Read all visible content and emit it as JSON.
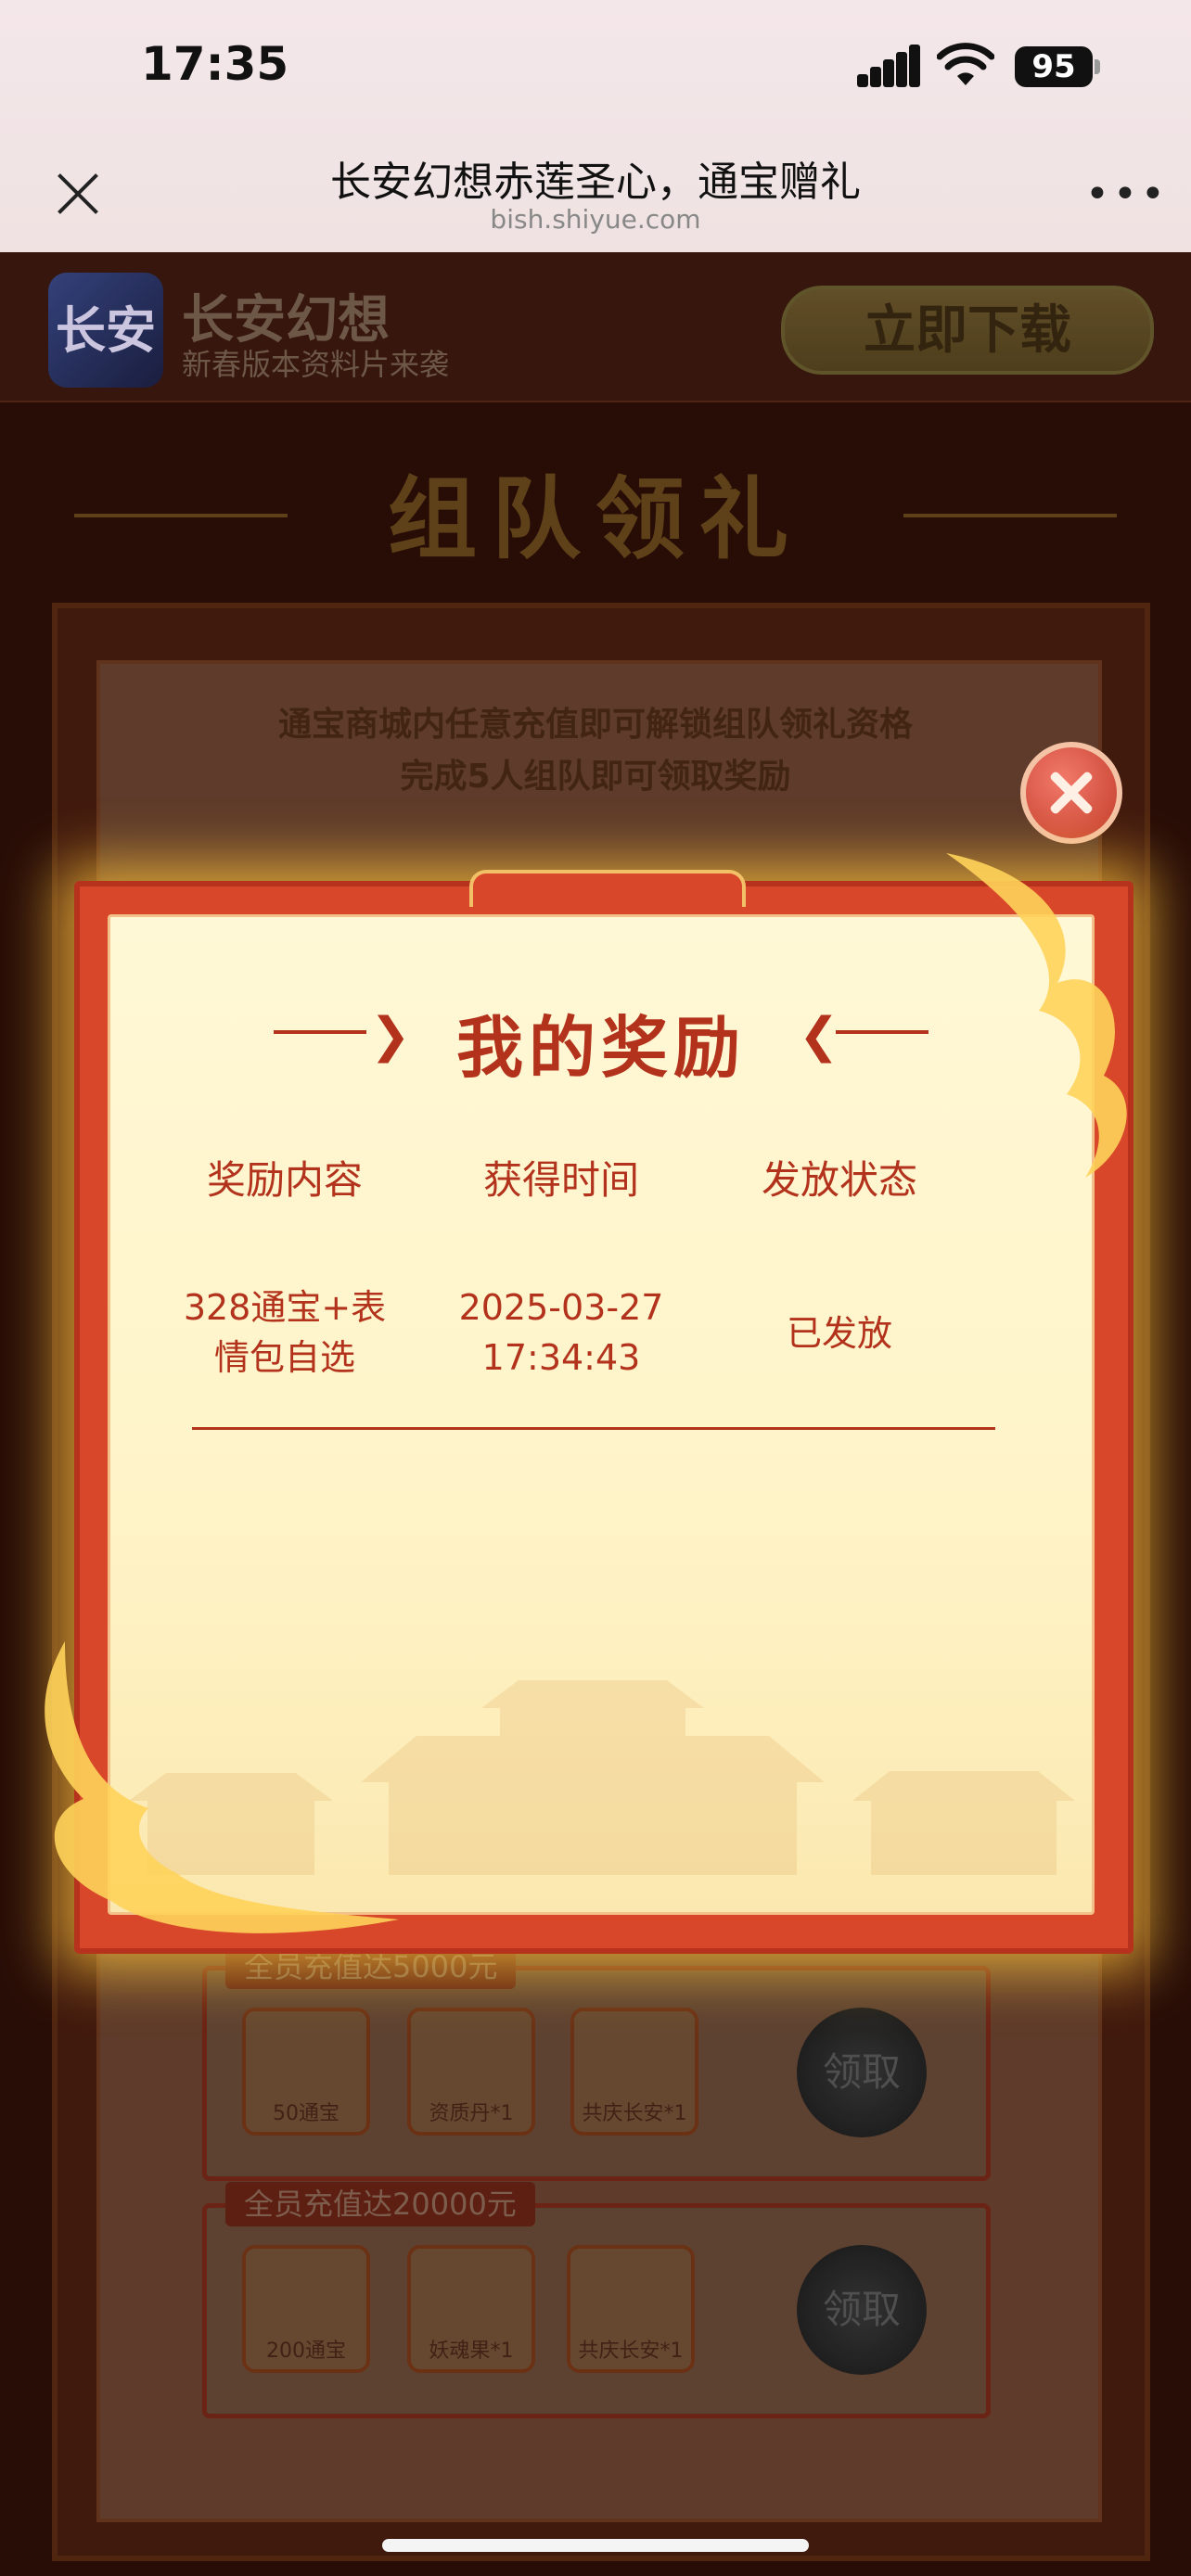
{
  "status_bar": {
    "time": "17:35",
    "battery": "95"
  },
  "browser": {
    "title": "长安幻想赤莲圣心，通宝赠礼",
    "url": "bish.shiyue.com"
  },
  "game_header": {
    "logo_text": "长安",
    "name": "长安幻想",
    "subtitle": "新春版本资料片来袭",
    "download_label": "立即下载"
  },
  "section": {
    "title": "组队领礼",
    "desc_line1": "通宝商城内任意充值即可解锁组队领礼资格",
    "desc_line2": "完成5人组队即可领取奖励"
  },
  "tiers": [
    {
      "label": "全员充值达5000元",
      "items": [
        "50通宝",
        "资质丹*1",
        "共庆长安*1"
      ],
      "claim_label": "领取"
    },
    {
      "label": "全员充值达20000元",
      "items": [
        "200通宝",
        "妖魂果*1",
        "共庆长安*1"
      ],
      "claim_label": "领取"
    }
  ],
  "modal": {
    "heading": "我的奖励",
    "columns": [
      "奖励内容",
      "获得时间",
      "发放状态"
    ],
    "rows": [
      {
        "content_line1": "328通宝+表",
        "content_line2": "情包自选",
        "time_line1": "2025-03-27",
        "time_line2": "17:34:43",
        "status": "已发放"
      }
    ]
  },
  "colors": {
    "accent": "#b3321c",
    "modal_frame": "#d8472a",
    "modal_bg": "#fff8d6",
    "glow": "#ffc43c"
  }
}
